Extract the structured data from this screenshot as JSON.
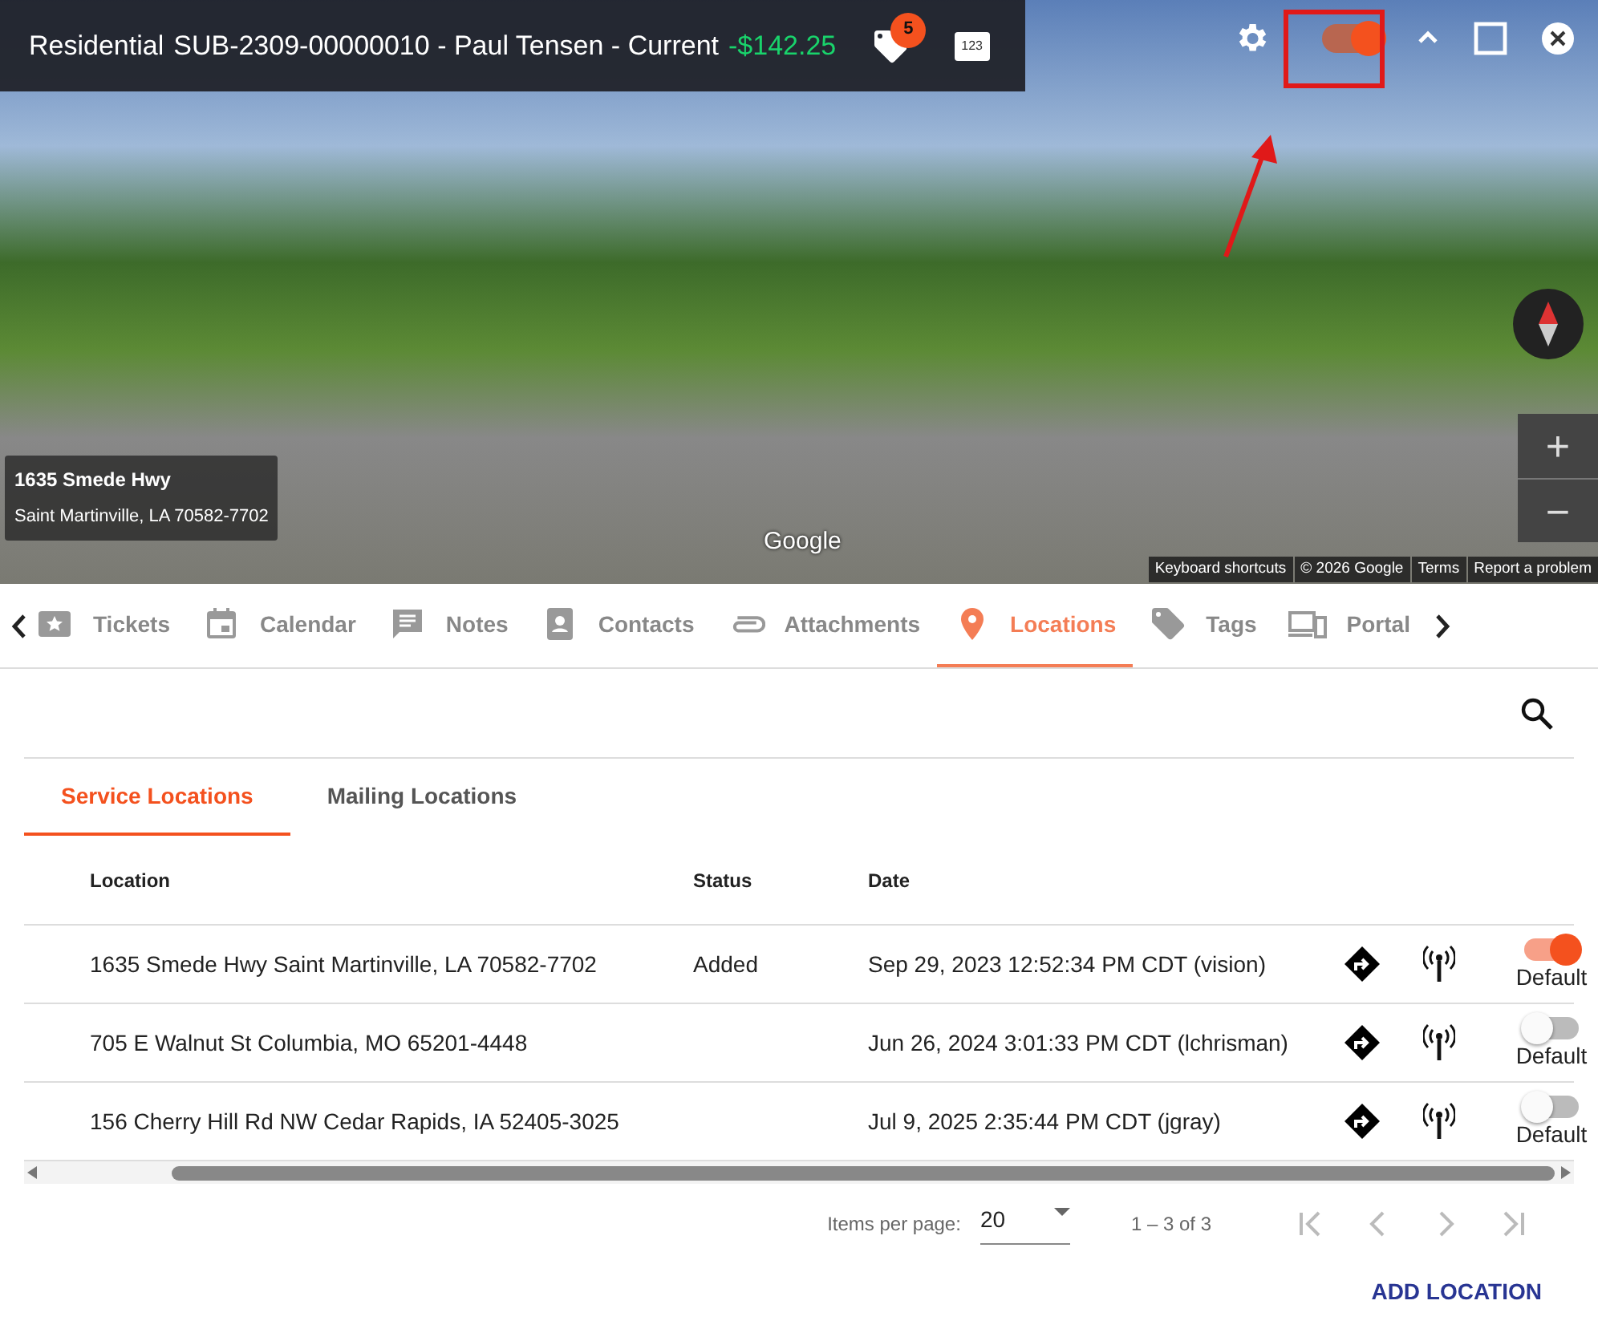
{
  "header": {
    "type": "Residential",
    "title": "SUB-2309-00000010 - Paul Tensen - Current",
    "balance": "-$142.25",
    "tag_count": "5",
    "id_badge": "123",
    "panel_toggle_on": true
  },
  "map": {
    "address_title": "1635 Smede Hwy",
    "address_line": "Saint Martinville, LA 70582-7702",
    "logo": "Google",
    "zoom_in": "+",
    "zoom_out": "−",
    "attributions": [
      "Keyboard shortcuts",
      "© 2026 Google",
      "Terms",
      "Report a problem"
    ]
  },
  "tabs": [
    {
      "label": "Tickets",
      "selected": false
    },
    {
      "label": "Calendar",
      "selected": false
    },
    {
      "label": "Notes",
      "selected": false
    },
    {
      "label": "Contacts",
      "selected": false
    },
    {
      "label": "Attachments",
      "selected": false
    },
    {
      "label": "Locations",
      "selected": true
    },
    {
      "label": "Tags",
      "selected": false
    },
    {
      "label": "Portal",
      "selected": false
    }
  ],
  "subtabs": [
    {
      "label": "Service Locations",
      "selected": true
    },
    {
      "label": "Mailing Locations",
      "selected": false
    }
  ],
  "table": {
    "columns": [
      "Location",
      "Status",
      "Date"
    ],
    "rows": [
      {
        "location": "1635 Smede Hwy Saint Martinville, LA 70582-7702",
        "status": "Added",
        "date": "Sep 29, 2023 12:52:34 PM CDT (vision)",
        "default": true,
        "default_label": "Default"
      },
      {
        "location": "705 E Walnut St Columbia, MO 65201-4448",
        "date": "Jun 26, 2024 3:01:33 PM CDT (lchrisman)",
        "default": false,
        "default_label": "Default"
      },
      {
        "location": "156 Cherry Hill Rd NW Cedar Rapids, IA 52405-3025",
        "date": "Jul 9, 2025 2:35:44 PM CDT (jgray)",
        "default": false,
        "default_label": "Default"
      }
    ]
  },
  "paginator": {
    "label": "Items per page:",
    "per_page": "20",
    "range": "1 – 3 of 3"
  },
  "add_button": "ADD LOCATION"
}
